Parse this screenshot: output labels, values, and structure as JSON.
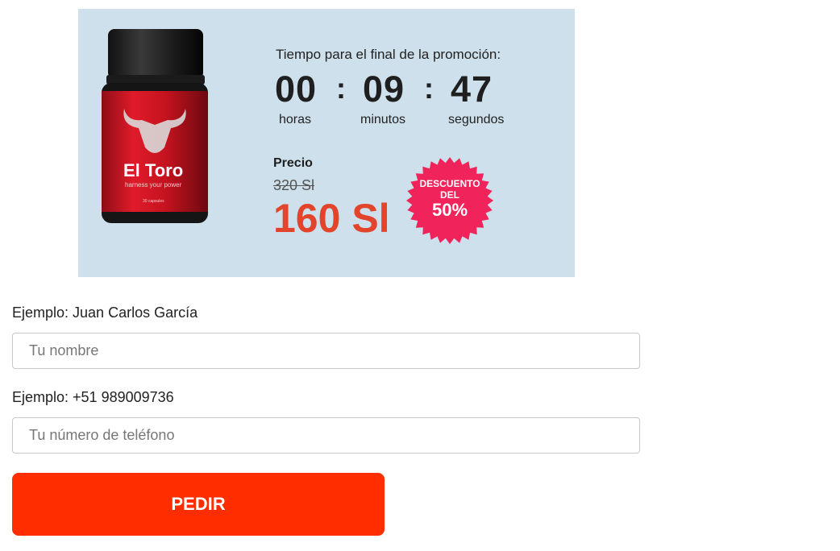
{
  "product": {
    "brand": "El Toro",
    "tagline": "harness your power",
    "capsules": "30 capsules"
  },
  "timer": {
    "title": "Tiempo para el final de la promoción:",
    "hours": "00",
    "minutes": "09",
    "seconds": "47",
    "hours_label": "horas",
    "minutes_label": "minutos",
    "seconds_label": "segundos",
    "separator": ":"
  },
  "price": {
    "label": "Precio",
    "old": "320 Sl",
    "new": "160 Sl"
  },
  "badge": {
    "line1": "DESCUENTO",
    "line2": "DEL",
    "line3": "50%",
    "color": "#f0245a"
  },
  "form": {
    "name_hint": "Ejemplo: Juan Carlos García",
    "name_placeholder": "Tu nombre",
    "phone_hint": "Ejemplo: +51 989009736",
    "phone_placeholder": "Tu número de teléfono",
    "submit_label": "PEDIR"
  },
  "colors": {
    "promo_bg": "#cde0ec",
    "price_accent": "#e2452b",
    "button": "#ff2d00"
  }
}
